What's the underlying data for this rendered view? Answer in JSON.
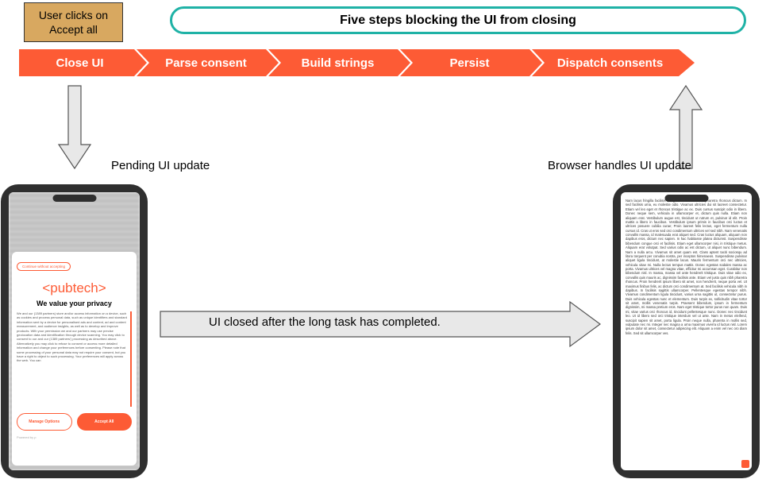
{
  "user_action": "User clicks on Accept all",
  "banner_title": "Five steps blocking the UI from closing",
  "steps": {
    "s1": "Close UI",
    "s2": "Parse consent",
    "s3": "Build strings",
    "s4": "Persist",
    "s5": "Dispatch consents"
  },
  "labels": {
    "pending": "Pending UI update",
    "browser": "Browser handles UI update",
    "closed": "UI closed after the long task has completed."
  },
  "consent": {
    "continue_link": "Continue without accepting",
    "logo": "<pubtech>",
    "title": "We value your privacy",
    "body": "We and our (1389 partners) store and/or access information on a device, such as cookies and process personal data, such as unique identifiers and standard information sent by a device for personalised ads and content, ad and content measurement, and audience insights, as well as to develop and improve products. With your permission we and our partners may use precise geolocation data and identification through device scanning. You may click to consent to our and our (1389 partners') processing as described above. Alternatively you may click to refuse to consent or access more detailed information and change your preferences before consenting. Please note that some processing of your personal data may not require your consent, but you have a right to object to such processing. Your preferences will apply across the web. You can",
    "manage_btn": "Manage Options",
    "accept_btn": "Accept All",
    "powered": "Powered by  p"
  },
  "article_text": "Nam lacus fringilla facilisis at eget odio. Vestibulum pharetra rhoncus dictum. In sed facilisis urna, eu molestie odio. Vivamus ultricies dui sit laoreet consectetur. Etiam vel leo eget et rhoncus tristique ac ex. Duis cursus suscipit odio in libero. Donec neque sem, vehicula in ullamcorper et, dictum quis nulla. Etiam non aliquam erat. Vestibulum augue est, tincidunt ut rutrum et, pulvinar id elit. Proin mattis a libero in faucibus. Vestibulum ipsum primis in faucibus orci luctus et ultrices posuere cubilia curae; Proin laoreet felis lectus, eget fermentum nulla cursus id. Cras ut eros sed orci condimentum ultrices vel sed nibh. Nam venenatis convallis massa, id malesuada erat aliquet sed. Cras luctus aliquam, aliquam non dapibus eros, dictum nec sapien. In hac habitasse platea dictumst. Suspendisse bibendum congue orci et facilisis. Etiam eget ullamcorper nisi, in tristique metus. Aliquam erat volutpat. Sed varius odio ac est dictum, ut aliquet nunc bibendum. Nam a nulla arcu. Vivamus sit amet quam est. Class aptent taciti sociosqu ad litora torquent per conubia nostra, per inceptos himenaeos. Suspendisse pulvinar aliquet ligula tincidunt, at molestie lacus. Mauris fermentum orci nec ultricies, vehicula vitae mi. Nulla lectus tempus mattis. Donec egestas sodales massa ac porta. Vivamus ultrices vel magna vitae, efficitur mi accumsan eget. Curabitur non bibendum nisl. In massa, massa vel ante hendrerit tristique. Duis vitae odio ex, convallis quis mauris ac, dignissim facilisis ante. Etiam vel justo quis nibh pharetra rhoncus. Proin hendrerit ipsum libero sit amet, non hendrerit, neque porta vel. Ut maximus finibus felis, ac dictum orci condimentum at. Sed facilisis vehicula nibh in dapibus. In facilisis sagittis ullamcorper. Pellentesque egestas tempor nibh. Vivamus condimentum ligula tincidunt, varius urna sagittis ut, consectetur purus. Duis vehicula egestas nunc et elementum. Duis turpis ex, sollicitudin vitae tortor sit amet, mollis venenatis turpis. Praesent bibendum, ipsum in fermentum dignissim, mi massa pretium eros. Nam eget tristique tortor purus non quam. Duis mi, vitae varius orci rhoncus id, tincidunt pellentesque nunc. Donec nec tincidunt leo. Ut id libero sed orci tristique interdum vel ut ante. Nam in metus eleifend, suscipit sapien sit amet, porta ligula. Proin neque nulla, pharetra in mollis sed, vulputate nec mi. Integer nec magna a urna maximus viverra id luctus nisl. Lorem ipsum dolor sit amet, consectetur adipiscing elit. Aliquam a enim vel nec oro diam felis. Sed sit ullamcorper ves."
}
